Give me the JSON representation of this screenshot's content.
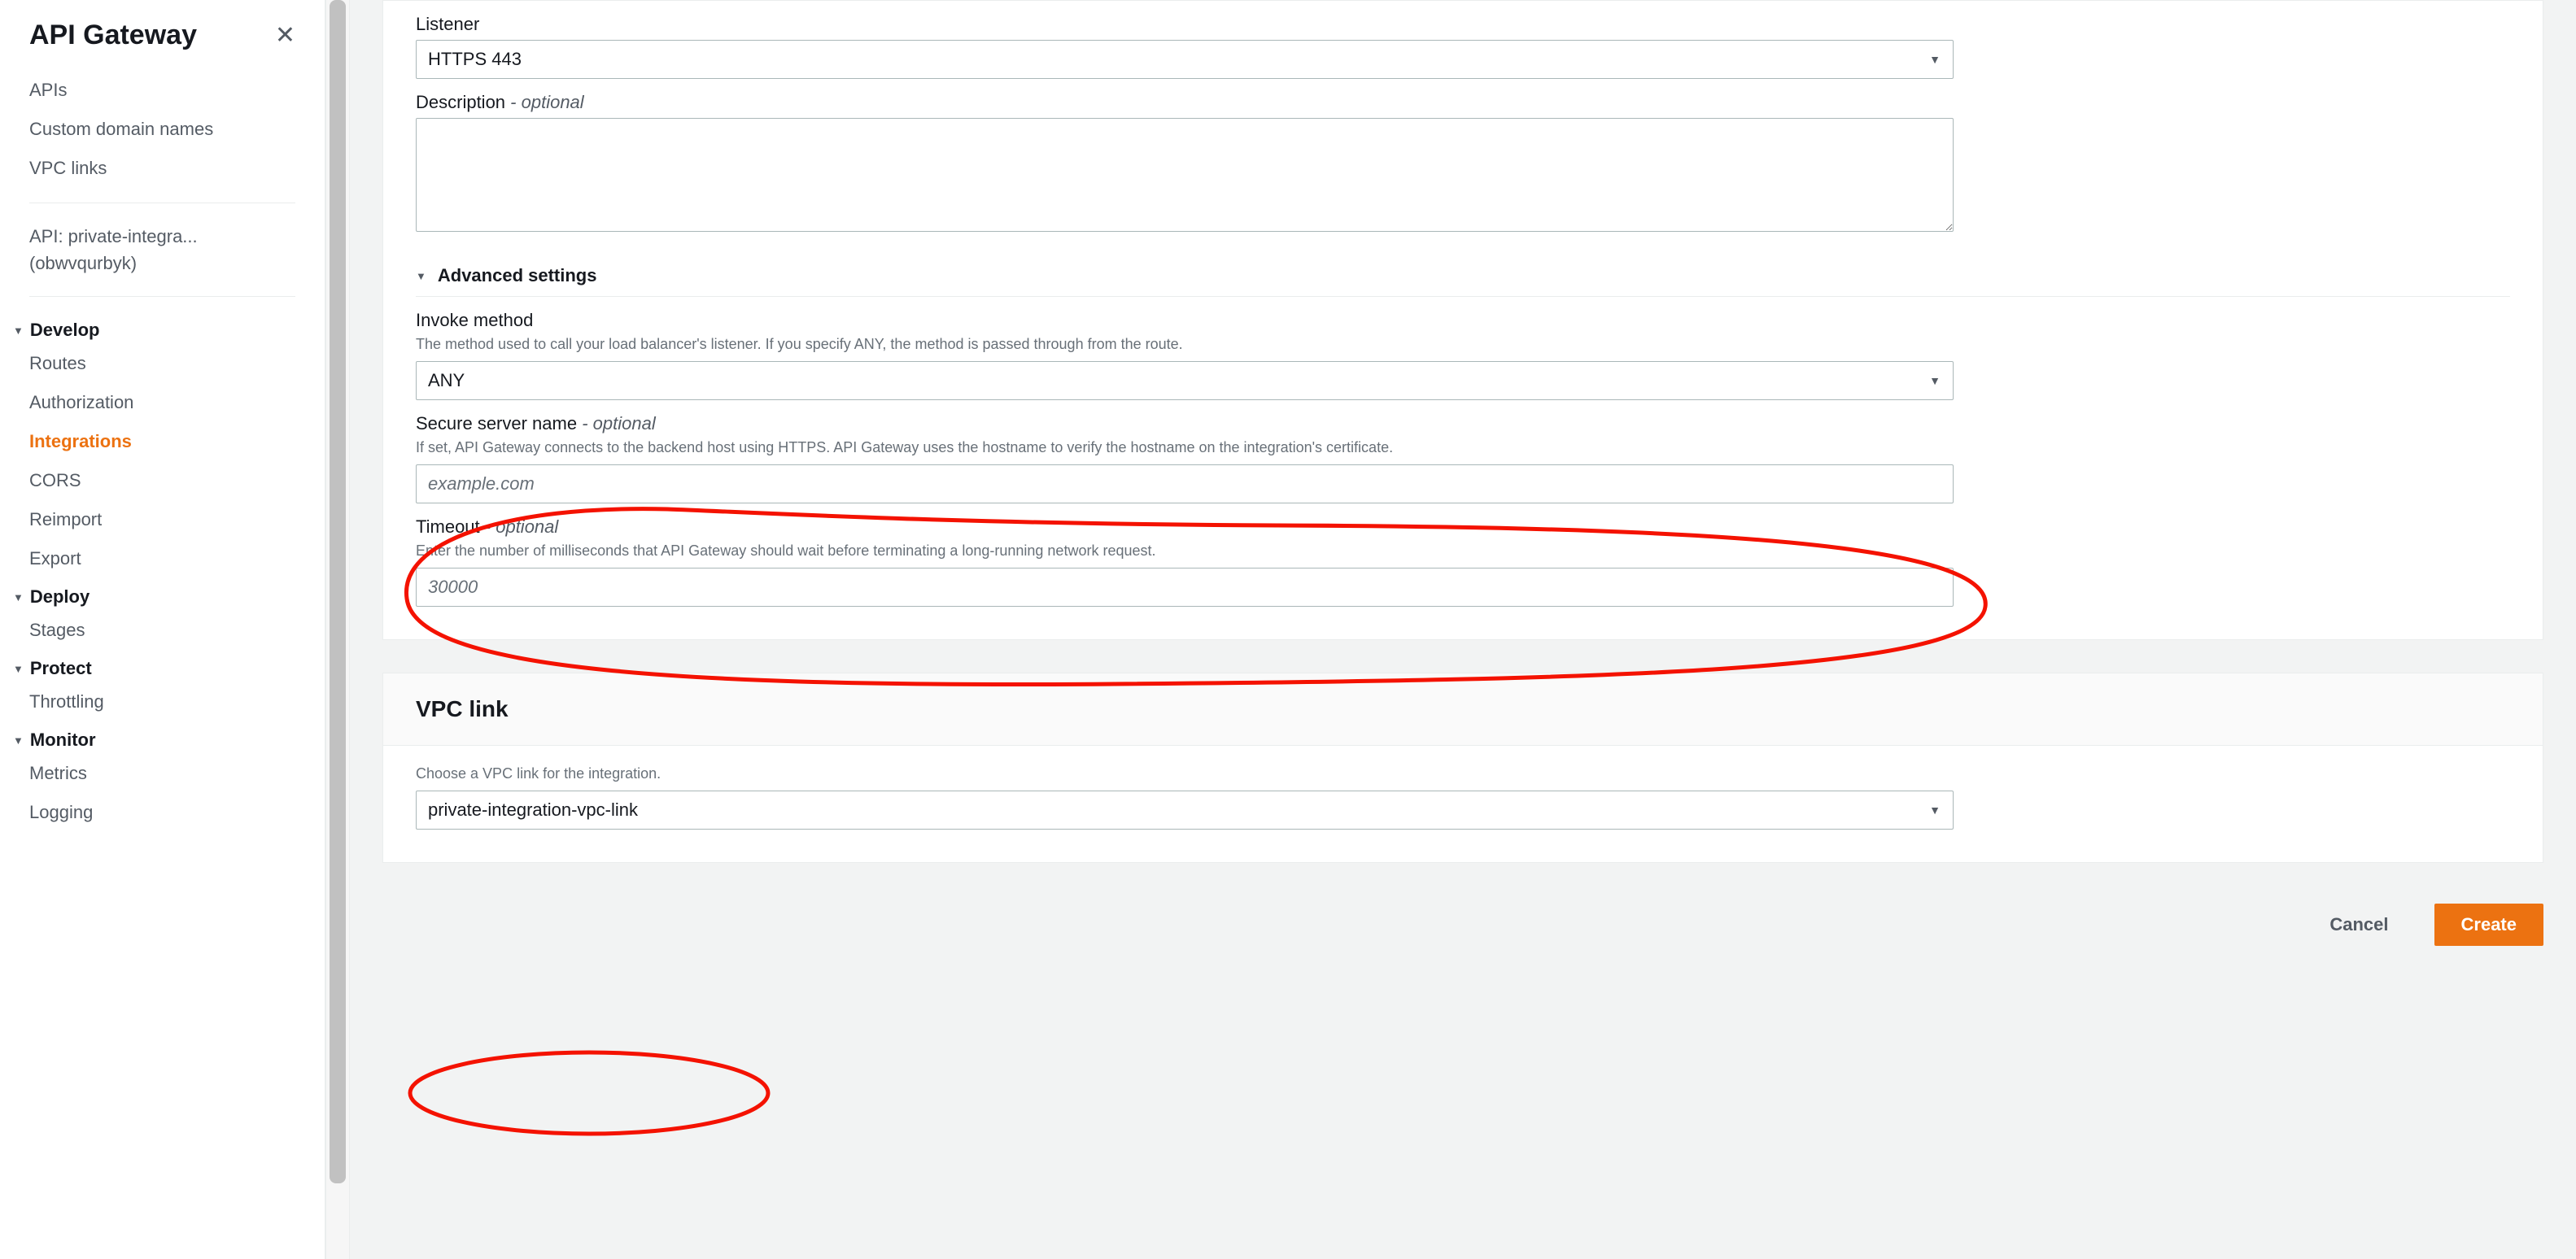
{
  "sidebar": {
    "title": "API Gateway",
    "top_links": [
      "APIs",
      "Custom domain names",
      "VPC links"
    ],
    "api_context_line1": "API: private-integra...",
    "api_context_line2": "(obwvqurbyk)",
    "sections": [
      {
        "title": "Develop",
        "items": [
          "Routes",
          "Authorization",
          "Integrations",
          "CORS",
          "Reimport",
          "Export"
        ],
        "active": "Integrations"
      },
      {
        "title": "Deploy",
        "items": [
          "Stages"
        ]
      },
      {
        "title": "Protect",
        "items": [
          "Throttling"
        ]
      },
      {
        "title": "Monitor",
        "items": [
          "Metrics",
          "Logging"
        ]
      }
    ]
  },
  "form": {
    "listener": {
      "label": "Listener",
      "value": "HTTPS 443"
    },
    "description": {
      "label": "Description",
      "optional": "- optional",
      "value": ""
    },
    "advanced": {
      "title": "Advanced settings"
    },
    "invoke_method": {
      "label": "Invoke method",
      "help": "The method used to call your load balancer's listener. If you specify ANY, the method is passed through from the route.",
      "value": "ANY"
    },
    "secure_server": {
      "label": "Secure server name",
      "optional": "- optional",
      "help": "If set, API Gateway connects to the backend host using HTTPS. API Gateway uses the hostname to verify the hostname on the integration's certificate.",
      "placeholder": "example.com",
      "value": ""
    },
    "timeout": {
      "label": "Timeout",
      "optional": "- optional",
      "help": "Enter the number of milliseconds that API Gateway should wait before terminating a long-running network request.",
      "placeholder": "30000",
      "value": ""
    }
  },
  "vpc_panel": {
    "title": "VPC link",
    "help": "Choose a VPC link for the integration.",
    "value": "private-integration-vpc-link"
  },
  "actions": {
    "cancel": "Cancel",
    "create": "Create"
  }
}
